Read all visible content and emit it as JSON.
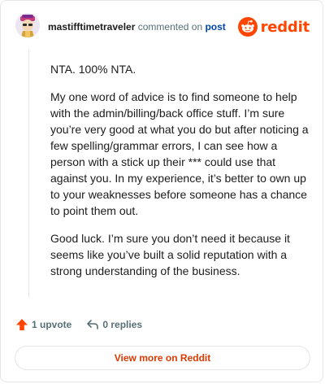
{
  "comment": {
    "username": "mastifftimetraveler",
    "action_text": "commented on",
    "post_link": "post",
    "brand": "reddit",
    "paragraphs": [
      "NTA. 100% NTA.",
      "My one word of advice is to find someone to help with the admin/billing/back office stuff. I’m sure you’re very good at what you do but after noticing a few spelling/grammar errors, I can see how a person with a stick up their *** could use that against you. In my experience, it’s better to own up to your weaknesses before someone has a chance to point them out.",
      "Good luck. I’m sure you don’t need it because it seems like you’ve built a solid reputation with a strong understanding of the business."
    ],
    "upvotes_label": "1 upvote",
    "replies_label": "0 replies",
    "view_more_label": "View more on Reddit"
  },
  "colors": {
    "brand": "#ff4500",
    "upvote_arrow": "#ff4500",
    "link": "#0045ac",
    "view_more": "#d93900"
  },
  "icons": {
    "avatar": "user-avatar",
    "brand": "reddit-logo-icon",
    "upvote": "upvote-arrow-icon",
    "reply": "reply-arrow-icon"
  }
}
